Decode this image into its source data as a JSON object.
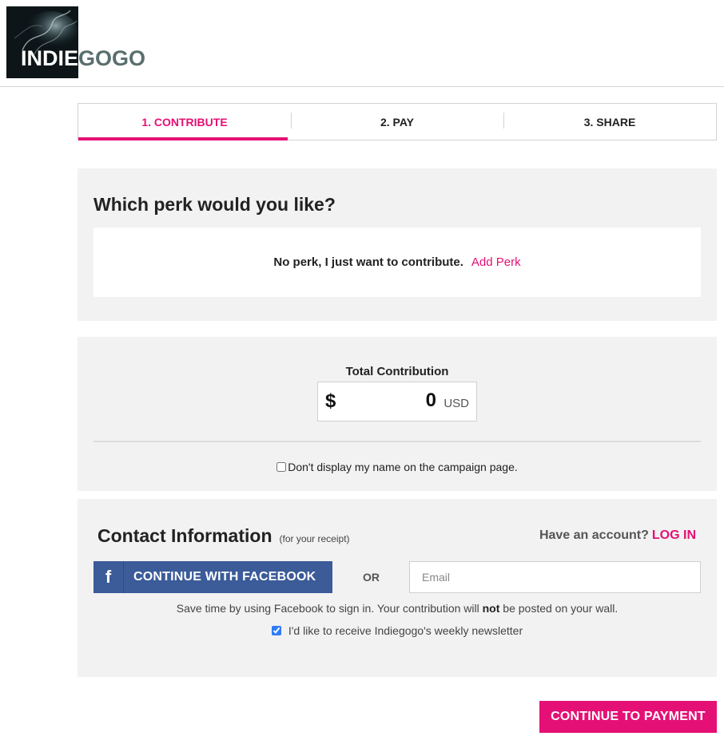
{
  "logo": {
    "text_part1": "INDIE",
    "text_part2": "GOGO"
  },
  "steps": [
    {
      "label": "1. CONTRIBUTE",
      "active": true
    },
    {
      "label": "2. PAY",
      "active": false
    },
    {
      "label": "3. SHARE",
      "active": false
    }
  ],
  "perk": {
    "title": "Which perk would you like?",
    "no_perk_text": "No perk, I just want to contribute.",
    "add_perk_label": "Add Perk"
  },
  "contribution": {
    "label": "Total Contribution",
    "currency_symbol": "$",
    "amount": "0",
    "currency": "USD",
    "anonymous_label": "Don't display my name on the campaign page.",
    "anonymous_checked": false
  },
  "contact": {
    "title": "Contact Information",
    "subtitle": "(for your receipt)",
    "account_prompt": "Have an account?",
    "login_label": "LOG IN",
    "facebook_icon": "f",
    "facebook_label": "CONTINUE WITH FACEBOOK",
    "or_label": "OR",
    "email_placeholder": "Email",
    "email_value": "",
    "fb_note_before": "Save time by using Facebook to sign in. Your contribution will ",
    "fb_note_bold": "not",
    "fb_note_after": " be posted on your wall.",
    "newsletter_label": "I'd like to receive Indiegogo's weekly newsletter",
    "newsletter_checked": true
  },
  "continue_label": "CONTINUE TO PAYMENT",
  "colors": {
    "accent": "#e51075",
    "facebook": "#3b5b99",
    "panel_bg": "#f2f2f2"
  }
}
